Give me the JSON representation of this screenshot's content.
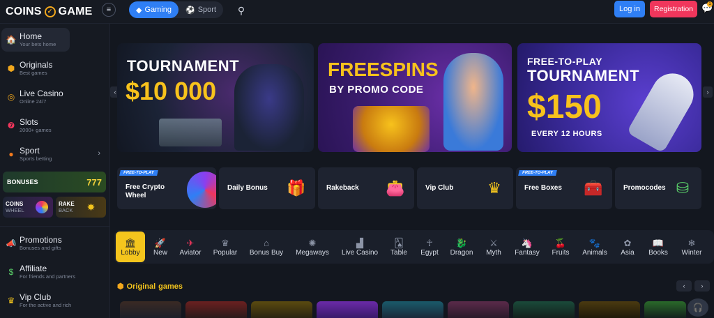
{
  "header": {
    "logo_left": "COINS",
    "logo_right": "GAME",
    "modes": [
      {
        "label": "Gaming",
        "icon": "gamepad-icon"
      },
      {
        "label": "Sport",
        "icon": "ball-icon"
      }
    ],
    "login_label": "Log in",
    "register_label": "Registration",
    "chat_badge": "1"
  },
  "sidebar": {
    "items": [
      {
        "label": "Home",
        "sub": "Your bets home",
        "icon": "home-icon"
      },
      {
        "label": "Originals",
        "sub": "Best games",
        "icon": "cube-icon"
      },
      {
        "label": "Live Casino",
        "sub": "Online 24/7",
        "icon": "roulette-icon"
      },
      {
        "label": "Slots",
        "sub": "2000+ games",
        "icon": "slots-icon"
      },
      {
        "label": "Sport",
        "sub": "Sports betting",
        "icon": "basketball-icon"
      }
    ],
    "bonuses": {
      "title": "BONUSES",
      "symbols": "777"
    },
    "wheel": {
      "line1": "COINS",
      "line2": "WHEEL"
    },
    "rake": {
      "line1": "RAKE",
      "line2": "BACK"
    },
    "bottom_items": [
      {
        "label": "Promotions",
        "sub": "Bonuses and gifts",
        "icon": "megaphone-icon"
      },
      {
        "label": "Affiliate",
        "sub": "For friends and partners",
        "icon": "money-icon"
      },
      {
        "label": "Vip Club",
        "sub": "For the active and rich",
        "icon": "crown-icon"
      }
    ]
  },
  "banners": [
    {
      "line1": "TOURNAMENT",
      "line2": "$10 000"
    },
    {
      "line1": "FREESPINS",
      "line2": "BY PROMO CODE"
    },
    {
      "line1": "FREE-TO-PLAY",
      "line2": "TOURNAMENT",
      "line3": "$150",
      "line4": "EVERY 12 HOURS"
    }
  ],
  "promos": [
    {
      "label": "Free Crypto Wheel",
      "tag": "FREE-TO-PLAY",
      "icon": "wheel-icon"
    },
    {
      "label": "Daily Bonus",
      "icon": "gift-icon"
    },
    {
      "label": "Rakeback",
      "icon": "wallet-icon"
    },
    {
      "label": "Vip Club",
      "icon": "vip-icon"
    },
    {
      "label": "Free Boxes",
      "tag": "FREE-TO-PLAY",
      "icon": "chest-icon"
    },
    {
      "label": "Promocodes",
      "icon": "chips-icon"
    }
  ],
  "categories": [
    {
      "label": "Lobby",
      "icon": "lobby-icon",
      "glyph": "🏛"
    },
    {
      "label": "New",
      "icon": "rocket-icon",
      "glyph": "🚀"
    },
    {
      "label": "Aviator",
      "icon": "plane-icon",
      "glyph": "✈"
    },
    {
      "label": "Popular",
      "icon": "crown-icon",
      "glyph": "♛"
    },
    {
      "label": "Bonus Buy",
      "icon": "bonus-icon",
      "glyph": "⌂"
    },
    {
      "label": "Megaways",
      "icon": "megaways-icon",
      "glyph": "✺"
    },
    {
      "label": "Live Casino",
      "icon": "live-icon",
      "glyph": "▟"
    },
    {
      "label": "Table",
      "icon": "cards-icon",
      "glyph": "🂡"
    },
    {
      "label": "Egypt",
      "icon": "ankh-icon",
      "glyph": "☥"
    },
    {
      "label": "Dragon",
      "icon": "dragon-icon",
      "glyph": "🐉"
    },
    {
      "label": "Myth",
      "icon": "swords-icon",
      "glyph": "⚔"
    },
    {
      "label": "Fantasy",
      "icon": "unicorn-icon",
      "glyph": "🦄"
    },
    {
      "label": "Fruits",
      "icon": "cherry-icon",
      "glyph": "🍒"
    },
    {
      "label": "Animals",
      "icon": "animal-icon",
      "glyph": "🐾"
    },
    {
      "label": "Asia",
      "icon": "lotus-icon",
      "glyph": "✿"
    },
    {
      "label": "Books",
      "icon": "book-icon",
      "glyph": "📖"
    },
    {
      "label": "Winter",
      "icon": "snow-icon",
      "glyph": "❄"
    }
  ],
  "section": {
    "title_accent": "Original",
    "title_rest": "games"
  },
  "colors": {
    "accent_blue": "#2f7ff5",
    "accent_red": "#f0365c",
    "accent_yellow": "#f4c51d",
    "background": "#13171f"
  }
}
